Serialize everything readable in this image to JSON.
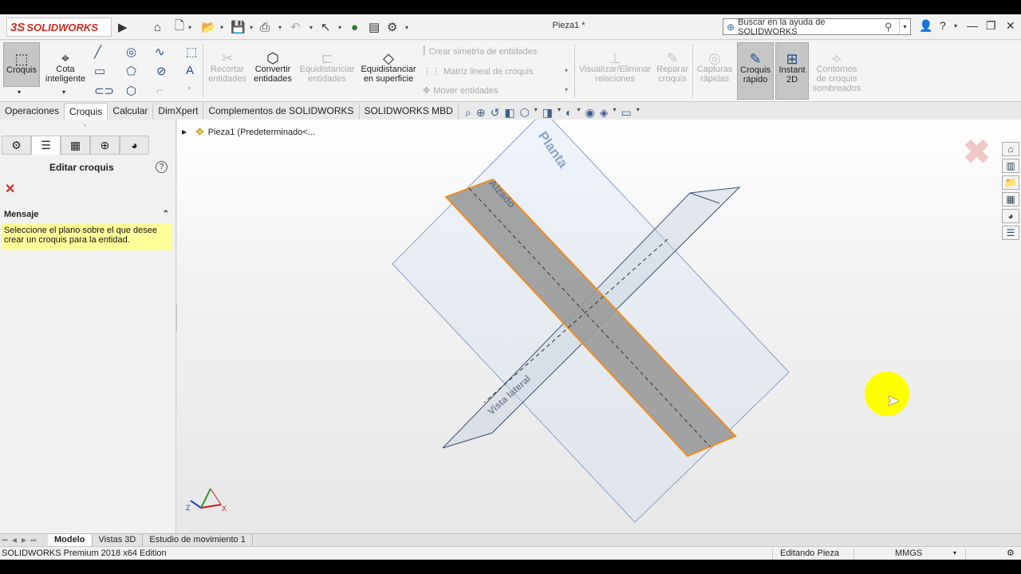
{
  "app": {
    "brand_prefix": "3S",
    "brand_name": "SOLIDWORKS",
    "doc_title": "Pieza1 *"
  },
  "search": {
    "placeholder": "Buscar en la ayuda de SOLIDWORKS"
  },
  "ribbon": {
    "croquis": "Croquis",
    "cota_line1": "Cota",
    "cota_line2": "inteligente",
    "recortar_line1": "Recortar",
    "recortar_line2": "entidades",
    "convertir_line1": "Convertir",
    "convertir_line2": "entidades",
    "equid_line1": "Equidistanciar",
    "equid_line2": "entidades",
    "equid_sup_line1": "Equidistanciar",
    "equid_sup_line2": "en superficie",
    "simetria": "Crear simetría de entidades",
    "matriz": "Matriz lineal de croquis",
    "mover": "Mover entidades",
    "visualizar_line1": "Visualizar/Eliminar",
    "visualizar_line2": "relaciones",
    "reparar_line1": "Reparar",
    "reparar_line2": "croquis",
    "capturas_line1": "Capturas",
    "capturas_line2": "rápidas",
    "rapido_line1": "Croquis",
    "rapido_line2": "rápido",
    "instant_line1": "Instant",
    "instant_line2": "2D",
    "contornos_line1": "Contornos",
    "contornos_line2": "de croquis",
    "contornos_line3": "sombreados"
  },
  "tabs": [
    "Operaciones",
    "Croquis",
    "Calcular",
    "DimXpert",
    "Complementos de SOLIDWORKS",
    "SOLIDWORKS MBD"
  ],
  "active_tab": "Croquis",
  "panel": {
    "title": "Editar croquis",
    "message_header": "Mensaje",
    "message": "Seleccione el plano sobre el que desee crear un croquis para la entidad."
  },
  "tree": {
    "root": "Pieza1  (Predeterminado<..."
  },
  "viewport": {
    "plane_top": "Planta",
    "plane_front": "Alzado",
    "plane_right": "Vista lateral",
    "triad_z": "Z",
    "triad_x": "X"
  },
  "bottom_tabs": [
    "Modelo",
    "Vistas 3D",
    "Estudio de movimiento 1"
  ],
  "status": {
    "left": "SOLIDWORKS Premium 2018 x64 Edition",
    "mode": "Editando Pieza",
    "units": "MMGS"
  },
  "colors": {
    "accent_red": "#d32b1e",
    "message_bg": "#ffff99",
    "selection": "#f0a030",
    "highlight": "#ffff00"
  }
}
